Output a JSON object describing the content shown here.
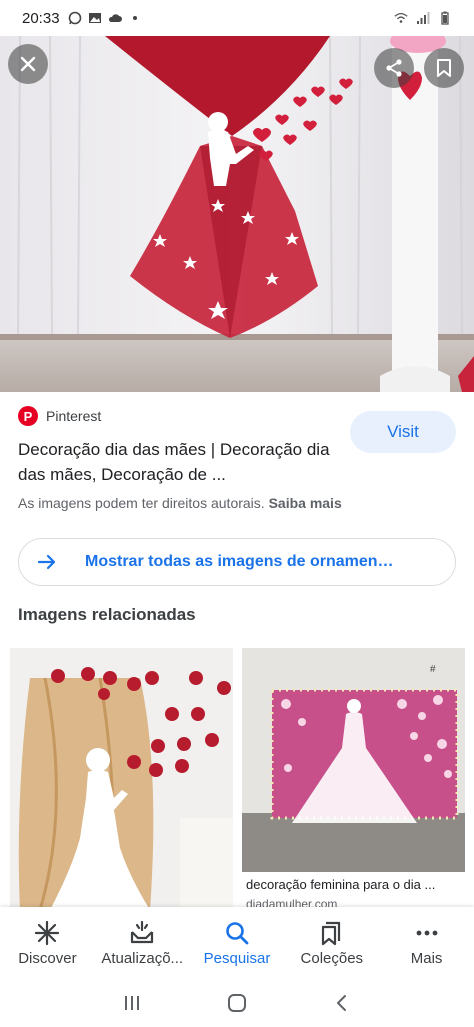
{
  "status_bar": {
    "time": "20:33"
  },
  "hero": {
    "close_icon": "close-icon",
    "share_icon": "share-icon",
    "bookmark_icon": "bookmark-icon"
  },
  "result": {
    "source": "Pinterest",
    "title": "Decoração dia das mães | Decoração dia das mães, Decoração de ...",
    "visit_label": "Visit",
    "copyright_text": "As imagens podem ter direitos autorais.",
    "learn_more": "Saiba mais"
  },
  "show_all": {
    "label": "Mostrar todas as imagens de ornamen…"
  },
  "related": {
    "heading": "Imagens relacionadas",
    "items": [
      {
        "caption": ""
      },
      {
        "caption": "decoração feminina para o dia ...",
        "domain": "diadamulher.com"
      }
    ]
  },
  "bottom_nav": {
    "items": [
      {
        "label": "Discover",
        "icon": "asterisk-icon"
      },
      {
        "label": "Atualizaçõ...",
        "icon": "updates-icon"
      },
      {
        "label": "Pesquisar",
        "icon": "search-icon"
      },
      {
        "label": "Coleções",
        "icon": "collections-icon"
      },
      {
        "label": "Mais",
        "icon": "more-icon"
      }
    ],
    "active_index": 2
  },
  "colors": {
    "accent": "#1a73e8",
    "pinterest": "#e60023",
    "visit_bg": "#e8f0fe"
  }
}
